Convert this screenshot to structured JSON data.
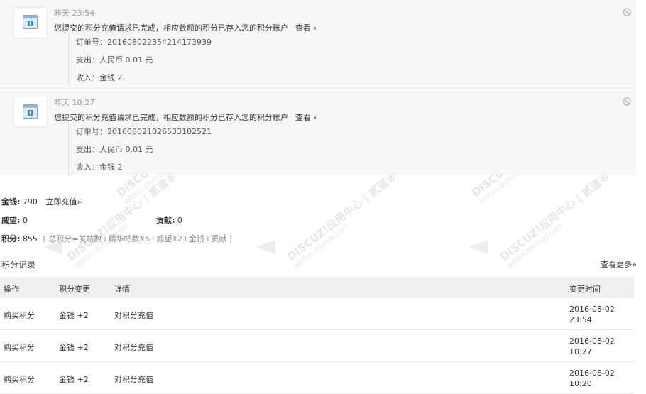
{
  "notifications": [
    {
      "time": "昨天 23:54",
      "message": "您提交的积分充值请求已完成，相应数额的积分已存入您的积分账户",
      "view_label": "查看 ›",
      "order": "订单号：20160802235421417393​9",
      "expense": "支出：人民币 0.01 元",
      "income": "收入：金钱 2"
    },
    {
      "time": "昨天 10:27",
      "message": "您提交的积分充值请求已完成，相应数额的积分已存入您的积分账户",
      "view_label": "查看 ›",
      "order": "订单号：201608021026533182521",
      "expense": "支出：人民币 0.01 元",
      "income": "收入：金钱 2"
    }
  ],
  "credits": {
    "money_label": "金钱:",
    "money_value": "790",
    "recharge_label": "立即充值»",
    "prestige_label": "威望:",
    "prestige_value": "0",
    "contribution_label": "贡献:",
    "contribution_value": "0",
    "points_label": "积分:",
    "points_value": "855",
    "points_formula": "( 总积分=发帖数+精华帖数X5+威望X2+金钱+贡献 )"
  },
  "log": {
    "title": "积分记录",
    "more_label": "查看更多»",
    "headers": [
      "操作",
      "积分变更",
      "详情",
      "变更时间"
    ],
    "rows": [
      {
        "action": "购买积分",
        "change": "金钱 +2",
        "detail": "对积分充值",
        "date": "2016-08-02",
        "time": "23:54"
      },
      {
        "action": "购买积分",
        "change": "金钱 +2",
        "detail": "对积分充值",
        "date": "2016-08-02",
        "time": "10:27"
      },
      {
        "action": "购买积分",
        "change": "金钱 +2",
        "detail": "对积分充值",
        "date": "2016-08-02",
        "time": "10:20"
      }
    ]
  },
  "watermark": {
    "brand": "DISCUZ!应用中心 | 贰道®",
    "url": "addon.dismall.com"
  },
  "icons": {
    "notice": "app-notice-icon",
    "ignore": "ignore-icon"
  }
}
